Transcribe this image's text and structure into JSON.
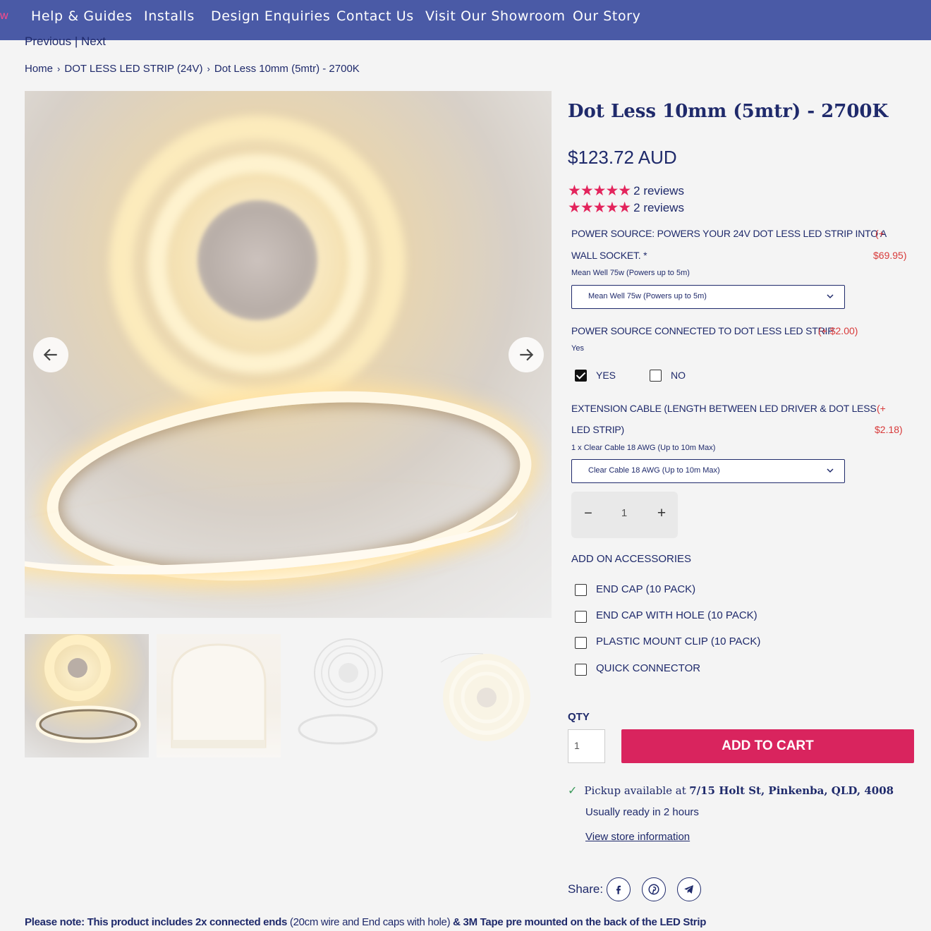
{
  "nav": {
    "edge_char": "w",
    "items": [
      "Help & Guides",
      "Installs",
      "Design Enquiries",
      "Contact Us",
      "Visit Our Showroom",
      "Our Story"
    ]
  },
  "pager": {
    "previous": "Previous",
    "divider": "|",
    "next": "Next"
  },
  "breadcrumb": [
    "Home",
    "DOT LESS LED STRIP (24V)",
    "Dot Less 10mm (5mtr) - 2700K"
  ],
  "product": {
    "title": "Dot Less 10mm (5mtr) - 2700K",
    "price": "$123.72 AUD",
    "rating_stars": 5,
    "reviews": [
      "2 reviews",
      "2 reviews"
    ]
  },
  "options": {
    "power_source": {
      "label_line1": "POWER SOURCE: POWERS YOUR 24V DOT LESS LED STRIP INTO A",
      "label_line2": "WALL SOCKET. *",
      "price_line1": "(+",
      "price_line2": "$69.95)",
      "selected_caption": "Mean Well 75w (Powers up to 5m)",
      "select_value": "Mean Well 75w (Powers up to 5m)"
    },
    "connected": {
      "label": "POWER SOURCE CONNECTED TO DOT LESS LED STRIP",
      "price": "(+ $2.00)",
      "selected_caption": "Yes",
      "yes_label": "YES",
      "no_label": "NO",
      "yes_checked": true,
      "no_checked": false
    },
    "extension": {
      "label_line1": "EXTENSION CABLE (LENGTH BETWEEN LED DRIVER & DOT LESS",
      "label_line2": "LED STRIP)",
      "price_line1": "(+",
      "price_line2": "$2.18)",
      "selected_caption": "1 x Clear Cable 18 AWG (Up to 10m Max)",
      "select_value": "Clear Cable 18 AWG (Up to 10m Max)"
    },
    "stepper": {
      "minus": "−",
      "value": "1",
      "plus": "+"
    }
  },
  "accessories": {
    "title": "ADD ON ACCESSORIES",
    "items": [
      "END CAP (10 PACK)",
      "END CAP WITH HOLE (10 PACK)",
      "PLASTIC MOUNT CLIP (10 PACK)",
      "QUICK CONNECTOR"
    ]
  },
  "purchase": {
    "qty_label": "QTY",
    "qty_value": "1",
    "add_to_cart": "ADD TO CART"
  },
  "pickup": {
    "tick": "✓",
    "prefix": "Pickup available at",
    "address": "7/15 Holt St, Pinkenba, QLD, 4008",
    "ready": "Usually ready in 2 hours",
    "store_link": "View store information"
  },
  "share": {
    "label": "Share:",
    "icons": [
      "facebook-icon",
      "pinterest-icon",
      "telegram-icon"
    ]
  },
  "note": {
    "part1": "Please note: This product includes 2x connected ends",
    "part2": " (20cm wire and End caps with hole) ",
    "part3": "& 3M Tape pre mounted on the back of the LED Strip"
  },
  "colors": {
    "nav_bg": "#4a5aa6",
    "text": "#1f2a6b",
    "accent": "#d9245e",
    "star": "#e3245c",
    "option_price": "#d83a3a"
  }
}
